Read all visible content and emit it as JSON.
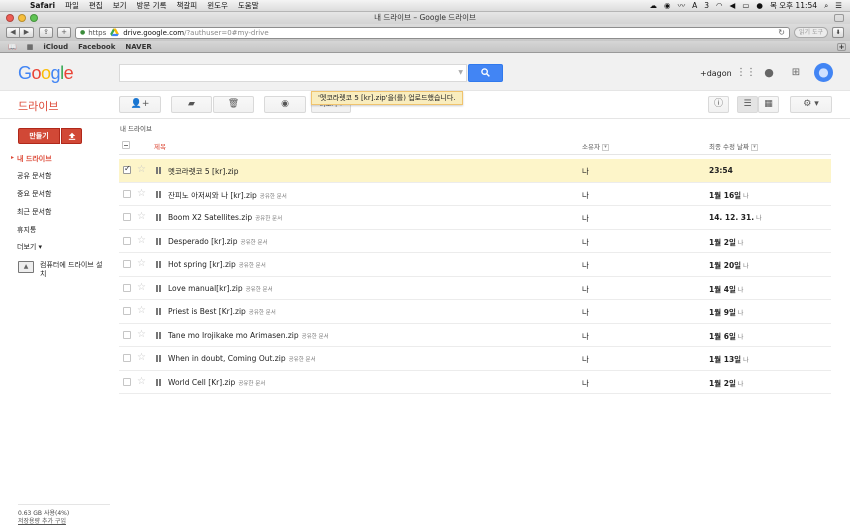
{
  "mac_menubar": {
    "app": "Safari",
    "menus": [
      "파일",
      "편집",
      "보기",
      "방문 기록",
      "책갈피",
      "윈도우",
      "도움말"
    ],
    "status_badge": "3",
    "clock": "목 오후 11:54"
  },
  "window": {
    "title": "내 드라이브 – Google 드라이브"
  },
  "browser": {
    "url_protocol": "https",
    "url_host": "drive.google.com",
    "url_path": "/?authuser=0#my-drive",
    "reader_label": "읽기 도구",
    "bookmarks": [
      "iCloud",
      "Facebook",
      "NAVER"
    ]
  },
  "google_header": {
    "logo": [
      "G",
      "o",
      "o",
      "g",
      "l",
      "e"
    ],
    "logo_colors": [
      "#4285f4",
      "#ea4335",
      "#fbbc05",
      "#4285f4",
      "#34a853",
      "#ea4335"
    ],
    "search_placeholder": "",
    "plus_user": "+dagon"
  },
  "drive": {
    "title": "드라이브",
    "more_label": "더보기",
    "toast": "'멧코라렛코 5 [kr].zip'을(를) 업로드했습니다.",
    "breadcrumb": "내 드라이브",
    "accent": "#dd4b39"
  },
  "sidebar": {
    "new_label": "만들기",
    "items": [
      {
        "label": "내 드라이브",
        "active": true
      },
      {
        "label": "공유 문서함"
      },
      {
        "label": "중요 문서함"
      },
      {
        "label": "최근 문서함"
      },
      {
        "label": "휴지통"
      },
      {
        "label": "더보기 ▾"
      }
    ],
    "install_label": "컴퓨터에 드라이브 설치",
    "storage_text": "0.63 GB 사용(4%)",
    "storage_link": "저장용량 추가 구입"
  },
  "list": {
    "columns": {
      "name": "제목",
      "owner": "소유자",
      "modified": "최종 수정 날짜"
    },
    "rows": [
      {
        "name": "멧코라렛코 5 [kr].zip",
        "shared": "",
        "owner": "나",
        "date": "23:54",
        "by": "",
        "selected": true
      },
      {
        "name": "잔피노 아저씨와 나 [kr].zip",
        "shared": "공유한 문서",
        "owner": "나",
        "date": "1월 16일",
        "by": "나"
      },
      {
        "name": "Boom X2 Satellites.zip",
        "shared": "공유한 문서",
        "owner": "나",
        "date": "14. 12. 31.",
        "by": "나"
      },
      {
        "name": "Desperado [kr].zip",
        "shared": "공유한 문서",
        "owner": "나",
        "date": "1월 2일",
        "by": "나"
      },
      {
        "name": "Hot spring [kr].zip",
        "shared": "공유한 문서",
        "owner": "나",
        "date": "1월 20일",
        "by": "나"
      },
      {
        "name": "Love manual[kr].zip",
        "shared": "공유한 문서",
        "owner": "나",
        "date": "1월 4일",
        "by": "나"
      },
      {
        "name": "Priest is Best [Kr].zip",
        "shared": "공유한 문서",
        "owner": "나",
        "date": "1월 9일",
        "by": "나"
      },
      {
        "name": "Tane mo Irojikake mo Arimasen.zip",
        "shared": "공유한 문서",
        "owner": "나",
        "date": "1월 6일",
        "by": "나"
      },
      {
        "name": "When in doubt, Coming Out.zip",
        "shared": "공유한 문서",
        "owner": "나",
        "date": "1월 13일",
        "by": "나"
      },
      {
        "name": "World Cell [Kr].zip",
        "shared": "공유한 문서",
        "owner": "나",
        "date": "1월 2일",
        "by": "나"
      }
    ]
  }
}
